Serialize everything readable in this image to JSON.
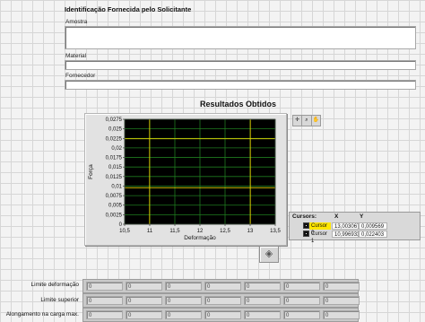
{
  "identification": {
    "title": "Identificação Fornecida pelo Solicitante",
    "amostra_label": "Amostra",
    "amostra_value": "",
    "material_label": "Material",
    "material_value": "",
    "fornecedor_label": "Fornecedor",
    "fornecedor_value": ""
  },
  "results": {
    "title": "Resultados Obtidos"
  },
  "colors": {
    "plot_background": "#000000",
    "grid": "#1f7a1f",
    "cursor_line": "#e6d200",
    "highlight": "#ffe600"
  },
  "chart_data": {
    "type": "line",
    "xlabel": "Deformação",
    "ylabel": "Força",
    "xlim": [
      10.5,
      13.5
    ],
    "ylim": [
      0,
      0.0275
    ],
    "x_ticks": [
      "10,5",
      "11",
      "11,5",
      "12",
      "12,5",
      "13",
      "13,5"
    ],
    "x_tick_values": [
      10.5,
      11,
      11.5,
      12,
      12.5,
      13,
      13.5
    ],
    "y_ticks": [
      "0,0275",
      "0,025",
      "0,0225",
      "0,02",
      "0,0175",
      "0,015",
      "0,0125",
      "0,01",
      "0,0075",
      "0,005",
      "0,0025",
      "0"
    ],
    "y_tick_values": [
      0.0275,
      0.025,
      0.0225,
      0.02,
      0.0175,
      0.015,
      0.0125,
      0.01,
      0.0075,
      0.005,
      0.0025,
      0
    ],
    "grid": true,
    "series": [],
    "cursors": [
      {
        "name": "Cursor 0",
        "x": 13.003067,
        "y": 0.009569
      },
      {
        "name": "Cursor 1",
        "x": 10.996933,
        "y": 0.022403
      }
    ]
  },
  "cursor_legend": {
    "header_name": "Cursors:",
    "header_x": "X",
    "header_y": "Y",
    "rows": [
      {
        "name": "Cursor 0",
        "x": "13,003067",
        "y": "0,009569"
      },
      {
        "name": "Cursor 1",
        "x": "10,996933",
        "y": "0,022403"
      }
    ]
  },
  "graph_palette": {
    "tools": [
      "crosshair-tool",
      "zoom-tool",
      "pan-tool"
    ]
  },
  "result_rows": [
    {
      "label": "Limite deformação",
      "values": [
        "0",
        "0",
        "0",
        "0",
        "0",
        "0",
        "0"
      ]
    },
    {
      "label": "Limite superior",
      "values": [
        "0",
        "0",
        "0",
        "0",
        "0",
        "0",
        "0"
      ]
    },
    {
      "label": "Alongamento na carga max.",
      "values": [
        "0",
        "0",
        "0",
        "0",
        "0",
        "0",
        "0"
      ]
    }
  ]
}
